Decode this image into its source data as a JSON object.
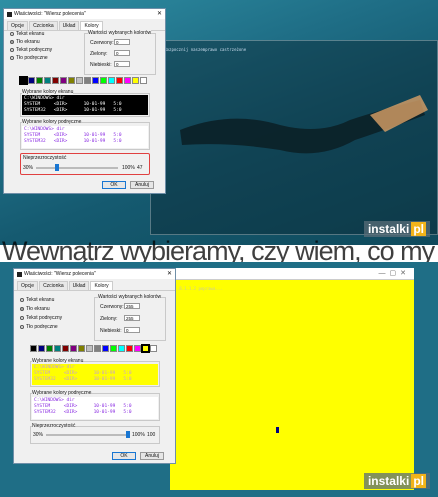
{
  "top": {
    "dialog_title": "Właściwości: \"Wiersz polecenia\"",
    "tabs": [
      "Opcje",
      "Czcionka",
      "Układ",
      "Kolory"
    ],
    "radios": [
      "Tekst ekranu",
      "Tło ekranu",
      "Tekst podręczny",
      "Tło podręczne"
    ],
    "selected_radio": 1,
    "values_group": "Wartości wybranych kolorów",
    "red_label": "Czerwony:",
    "red_value": "0",
    "green_label": "Zielony:",
    "green_value": "0",
    "blue_label": "Niebieski:",
    "blue_value": "0",
    "screen_group": "Wybrane kolory ekranu",
    "screen_preview": "C:\\WINDOWS> dir\nSYSTEM     <DIR>      10-01-99   5:0\nSYSTEM32   <DIR>      10-01-99   5:0",
    "popup_group": "Wybrane kolory podręczne",
    "popup_preview": "C:\\WINDOWS> dir\nSYSTEM     <DIR>      10-01-99   5:0\nSYSTEM32   <DIR>      10-01-99   5:0",
    "opacity_group": "Nieprzezroczystość",
    "opacity_min": "30%",
    "opacity_max": "100%",
    "opacity_value": "47",
    "opacity_fraction": 0.24,
    "ok": "OK",
    "cancel": "Anuluj",
    "console_line": "w: Rozpocznij naszemprawo castrzeżone"
  },
  "overlay_text": "Wewnątrz wybieramy, czy wiem, co my chcesz i po jakim stopniu może",
  "bottom": {
    "dialog_title": "Właściwości: \"Wiersz polecenia\"",
    "tabs": [
      "Opcje",
      "Czcionka",
      "Układ",
      "Kolory"
    ],
    "radios": [
      "Tekst ekranu",
      "Tło ekranu",
      "Tekst podręczny",
      "Tło podręczne"
    ],
    "selected_radio": 1,
    "values_group": "Wartości wybranych kolorów",
    "red_label": "Czerwony:",
    "red_value": "255",
    "green_label": "Zielony:",
    "green_value": "255",
    "blue_label": "Niebieski:",
    "blue_value": "0",
    "screen_group": "Wybrane kolory ekranu",
    "screen_preview": "C:\\WINDOWS> dir\nSYSTEM     <DIR>      10-01-99   5:0\nSYSTEM32   <DIR>      10-01-99   5:0",
    "popup_group": "Wybrane kolory podręczne",
    "popup_preview": "C:\\WINDOWS> dir\nSYSTEM     <DIR>      10-01-99   5:0\nSYSTEM32   <DIR>      10-01-99   5:0",
    "opacity_group": "Nieprzezroczystość",
    "opacity_min": "30%",
    "opacity_max": "100%",
    "opacity_value": "100",
    "opacity_fraction": 1.0,
    "ok": "OK",
    "cancel": "Anuluj",
    "console_line": "...8.1.1.2 poprawa..."
  },
  "watermark": {
    "text": "instalki",
    "suffix": "pl"
  },
  "palette": [
    "#000000",
    "#000080",
    "#008000",
    "#008080",
    "#800000",
    "#800080",
    "#808000",
    "#c0c0c0",
    "#808080",
    "#0000ff",
    "#00ff00",
    "#00ffff",
    "#ff0000",
    "#ff00ff",
    "#ffff00",
    "#ffffff"
  ],
  "colors": {
    "accent": "#1976d2",
    "highlight": "#e04040",
    "console_bg_top": "#000000",
    "console_bg_bottom": "#ffff00",
    "popup_text": "#8a2be2"
  }
}
